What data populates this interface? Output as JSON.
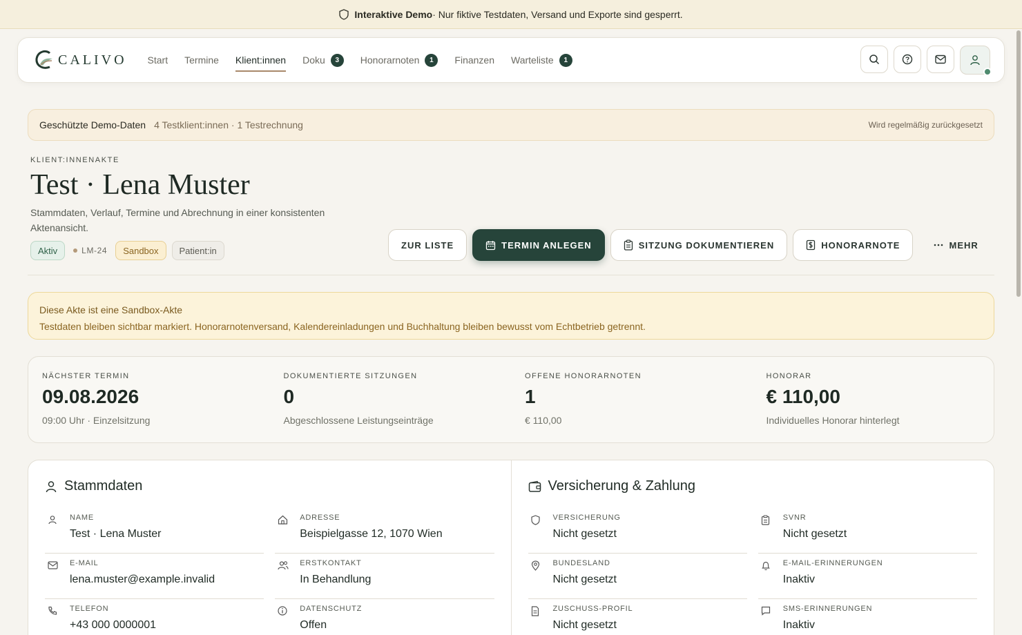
{
  "demo_banner": {
    "bold": "Interaktive Demo",
    "text": " · Nur fiktive Testdaten, Versand und Exporte sind gesperrt."
  },
  "nav": {
    "logo": "CALIVO",
    "items": [
      {
        "label": "Start"
      },
      {
        "label": "Termine"
      },
      {
        "label": "Klient:innen",
        "active": true
      },
      {
        "label": "Doku",
        "badge": "3"
      },
      {
        "label": "Honorarnoten",
        "badge": "1"
      },
      {
        "label": "Finanzen"
      },
      {
        "label": "Warteliste",
        "badge": "1"
      }
    ],
    "icons": [
      "search-icon",
      "help-icon",
      "mail-icon",
      "user-icon"
    ]
  },
  "info_strip": {
    "title": "Geschützte Demo-Daten",
    "detail": "4 Testklient:innen · 1 Testrechnung",
    "right": "Wird regelmäßig zurückgesetzt"
  },
  "header": {
    "eyebrow": "KLIENT:INNENAKTE",
    "title": "Test · Lena Muster",
    "subtitle": "Stammdaten, Verlauf, Termine und Abrechnung in einer konsistenten Aktenansicht.",
    "tags": {
      "status": "Aktiv",
      "id": "LM-24",
      "sandbox": "Sandbox",
      "role": "Patient:in"
    }
  },
  "actions": {
    "back": "ZUR LISTE",
    "new_appointment": "TERMIN ANLEGEN",
    "document_session": "SITZUNG DOKUMENTIEREN",
    "invoice": "HONORARNOTE",
    "more": "MEHR"
  },
  "alert": {
    "title": "Diese Akte ist eine Sandbox-Akte",
    "text": "Testdaten bleiben sichtbar markiert. Honorarnotenversand, Kalendereinladungen und Buchhaltung bleiben bewusst vom Echtbetrieb getrennt."
  },
  "stats": [
    {
      "label": "NÄCHSTER TERMIN",
      "value": "09.08.2026",
      "sub": "09:00 Uhr · Einzelsitzung"
    },
    {
      "label": "DOKUMENTIERTE SITZUNGEN",
      "value": "0",
      "sub": "Abgeschlossene Leistungseinträge"
    },
    {
      "label": "OFFENE HONORARNOTEN",
      "value": "1",
      "sub": "€ 110,00"
    },
    {
      "label": "HONORAR",
      "value": "€ 110,00",
      "sub": "Individuelles Honorar hinterlegt"
    }
  ],
  "stammdaten": {
    "title": "Stammdaten",
    "fields": [
      {
        "label": "NAME",
        "value": "Test · Lena Muster"
      },
      {
        "label": "ADRESSE",
        "value": "Beispielgasse 12, 1070 Wien"
      },
      {
        "label": "E-MAIL",
        "value": "lena.muster@example.invalid"
      },
      {
        "label": "ERSTKONTAKT",
        "value": "In Behandlung"
      },
      {
        "label": "TELEFON",
        "value": "+43 000 0000001"
      },
      {
        "label": "DATENSCHUTZ",
        "value": "Offen"
      }
    ]
  },
  "versicherung": {
    "title": "Versicherung & Zahlung",
    "fields": [
      {
        "label": "VERSICHERUNG",
        "value": "Nicht gesetzt"
      },
      {
        "label": "SVNR",
        "value": "Nicht gesetzt"
      },
      {
        "label": "BUNDESLAND",
        "value": "Nicht gesetzt"
      },
      {
        "label": "E-MAIL-ERINNERUNGEN",
        "value": "Inaktiv"
      },
      {
        "label": "ZUSCHUSS-PROFIL",
        "value": "Nicht gesetzt"
      },
      {
        "label": "SMS-ERINNERUNGEN",
        "value": "Inaktiv"
      }
    ]
  }
}
